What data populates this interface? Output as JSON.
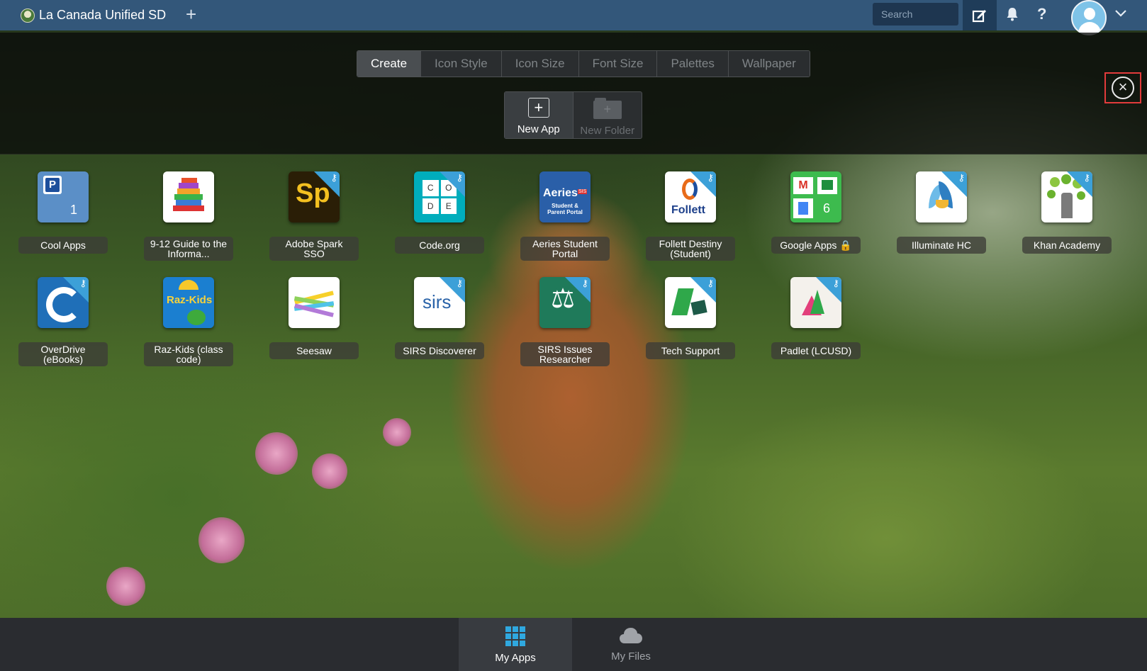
{
  "topbar": {
    "org_name": "La Canada Unified SD",
    "add_tab": "+",
    "search_placeholder": "Search",
    "help": "?"
  },
  "edit_panel": {
    "tabs": [
      {
        "label": "Create",
        "active": true
      },
      {
        "label": "Icon Style",
        "active": false
      },
      {
        "label": "Icon Size",
        "active": false
      },
      {
        "label": "Font Size",
        "active": false
      },
      {
        "label": "Palettes",
        "active": false
      },
      {
        "label": "Wallpaper",
        "active": false
      }
    ],
    "new_app": "New App",
    "new_folder": "New Folder",
    "plus": "+"
  },
  "apps": [
    {
      "label": "Cool Apps",
      "icon": "folder-p-icon",
      "badge": "1"
    },
    {
      "label": "9-12 Guide to the Informa...",
      "icon": "books-icon"
    },
    {
      "label": "Adobe Spark SSO",
      "icon": "adobe-spark-icon",
      "text": "Sp"
    },
    {
      "label": "Code.org",
      "icon": "code-org-icon",
      "letters": [
        "C",
        "O",
        "D",
        "E"
      ]
    },
    {
      "label": "Aeries Student Portal",
      "icon": "aeries-icon",
      "text": "Aeries",
      "sub": "Student & Parent Portal",
      "tag": "SIS"
    },
    {
      "label": "Follett Destiny (Student)",
      "icon": "follett-icon",
      "text": "Follett"
    },
    {
      "label": "Google Apps",
      "icon": "google-apps-icon",
      "badge": "6",
      "locked": true
    },
    {
      "label": "Illuminate HC",
      "icon": "illuminate-icon"
    },
    {
      "label": "Khan Academy",
      "icon": "khan-academy-icon"
    },
    {
      "label": "OverDrive (eBooks)",
      "icon": "overdrive-icon"
    },
    {
      "label": "Raz-Kids (class code)",
      "icon": "raz-kids-icon",
      "text": "Raz-Kids"
    },
    {
      "label": "Seesaw",
      "icon": "seesaw-icon"
    },
    {
      "label": "SIRS Discoverer",
      "icon": "sirs-icon",
      "text": "sirs"
    },
    {
      "label": "SIRS Issues Researcher",
      "icon": "scales-icon"
    },
    {
      "label": "Tech Support",
      "icon": "tech-support-icon"
    },
    {
      "label": "Padlet (LCUSD)",
      "icon": "padlet-icon"
    }
  ],
  "bottom_nav": {
    "my_apps": "My Apps",
    "my_files": "My Files"
  },
  "colors": {
    "topbar": "#33577a",
    "sso_corner": "#3ca0d8",
    "close_highlight": "#e23b3b"
  }
}
